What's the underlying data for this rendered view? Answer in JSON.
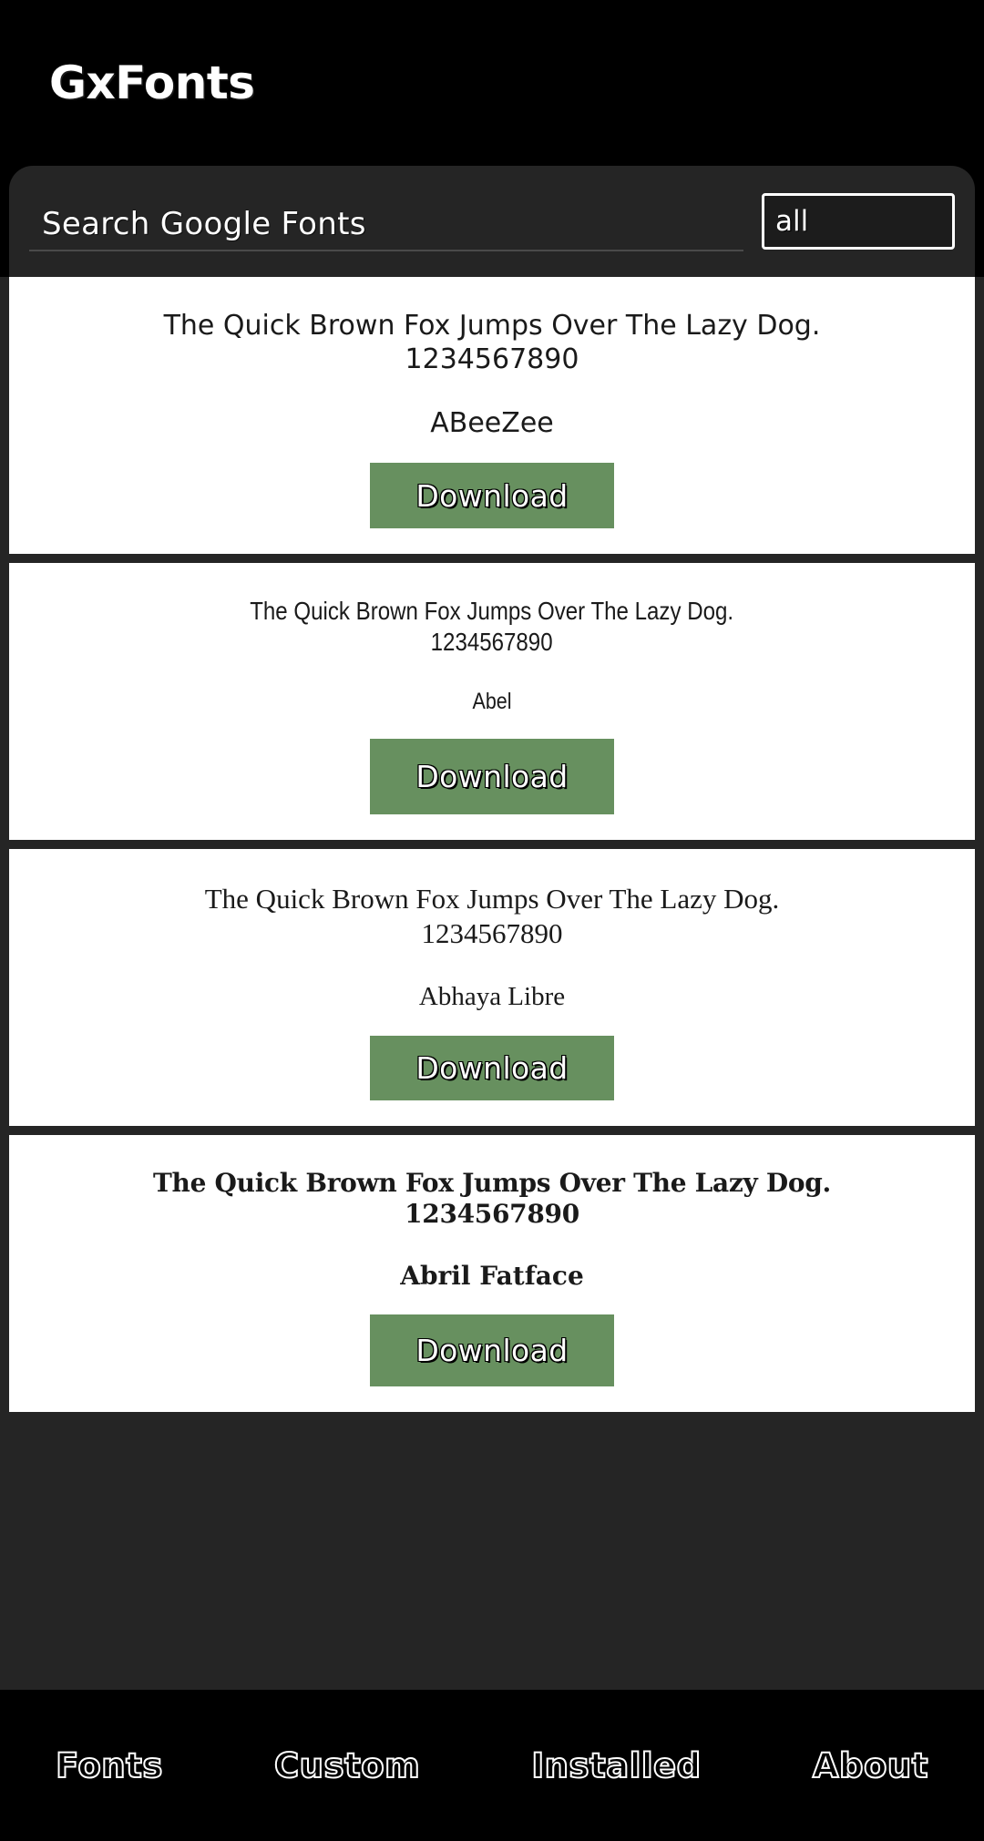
{
  "app": {
    "logo": "GxFonts"
  },
  "search": {
    "placeholder": "Search Google Fonts",
    "value": "",
    "filter_value": "all",
    "filter_options": [
      "all"
    ]
  },
  "theme": {
    "background": "#000000",
    "panel": "#252525",
    "card": "#ffffff",
    "accent_button": "#67905f",
    "text_light": "#ffffff",
    "text_dark": "#1a1a1a"
  },
  "fonts": [
    {
      "sample_text": "The Quick Brown Fox Jumps Over The Lazy Dog.",
      "sample_numbers": "1234567890",
      "name": "ABeeZee",
      "download_label": "Download"
    },
    {
      "sample_text": "The Quick Brown Fox Jumps Over The Lazy Dog.",
      "sample_numbers": "1234567890",
      "name": "Abel",
      "download_label": "Download"
    },
    {
      "sample_text": "The Quick Brown Fox Jumps Over The Lazy Dog.",
      "sample_numbers": "1234567890",
      "name": "Abhaya Libre",
      "download_label": "Download"
    },
    {
      "sample_text": "The Quick Brown Fox Jumps Over The Lazy Dog.",
      "sample_numbers": "1234567890",
      "name": "Abril Fatface",
      "download_label": "Download"
    }
  ],
  "bottom_nav": {
    "items": [
      {
        "label": "Fonts"
      },
      {
        "label": "Custom"
      },
      {
        "label": "Installed"
      },
      {
        "label": "About"
      }
    ]
  }
}
